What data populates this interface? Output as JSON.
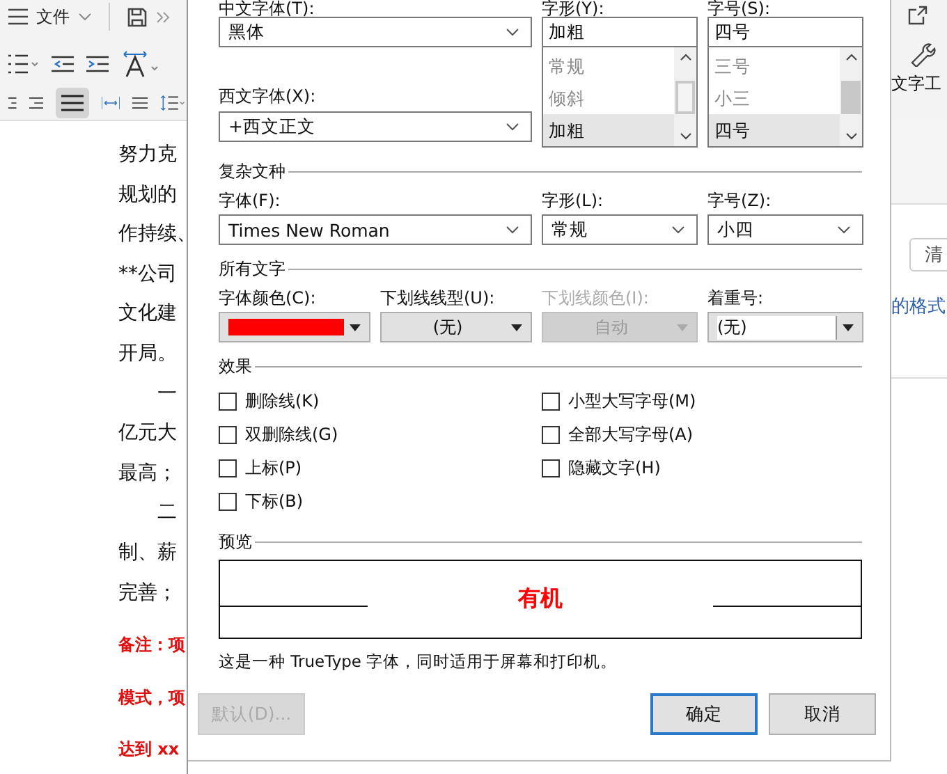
{
  "toolbar": {
    "menu_label": "文件"
  },
  "document": {
    "lines": [
      {
        "text": "努力克",
        "kind": "body"
      },
      {
        "text": "规划的",
        "kind": "body"
      },
      {
        "text": "作持续、",
        "kind": "body"
      },
      {
        "text": "**公司",
        "kind": "body"
      },
      {
        "text": "文化建",
        "kind": "body"
      },
      {
        "text": "开局。",
        "kind": "body"
      },
      {
        "text": "一",
        "kind": "indented"
      },
      {
        "text": "亿元大",
        "kind": "body"
      },
      {
        "text": "最高；",
        "kind": "body"
      },
      {
        "text": "二",
        "kind": "indented"
      },
      {
        "text": "制、薪",
        "kind": "body"
      },
      {
        "text": "完善；",
        "kind": "body"
      },
      {
        "text": "备注：项",
        "kind": "note"
      },
      {
        "text": "模式，项",
        "kind": "note"
      },
      {
        "text": "达到 xx",
        "kind": "note"
      }
    ]
  },
  "side_panel": {
    "tool_label": "文字工",
    "clear_button": "清",
    "link": "的格式"
  },
  "dialog": {
    "chinese_font": {
      "label": "中文字体(T):",
      "value": "黑体"
    },
    "style": {
      "label": "字形(Y):",
      "value": "加粗",
      "options": [
        {
          "label": "常规",
          "selected": false
        },
        {
          "label": "倾斜",
          "selected": false
        },
        {
          "label": "加粗",
          "selected": true
        }
      ]
    },
    "size": {
      "label": "字号(S):",
      "value": "四号",
      "options": [
        {
          "label": "三号",
          "selected": false
        },
        {
          "label": "小三",
          "selected": false
        },
        {
          "label": "四号",
          "selected": true
        }
      ]
    },
    "western_font": {
      "label": "西文字体(X):",
      "value": "+西文正文"
    },
    "complex_section": "复杂文种",
    "complex_font": {
      "label": "字体(F):",
      "value": "Times New Roman"
    },
    "complex_style": {
      "label": "字形(L):",
      "value": "常规"
    },
    "complex_size": {
      "label": "字号(Z):",
      "value": "小四"
    },
    "all_text_section": "所有文字",
    "font_color": {
      "label": "字体颜色(C):",
      "color": "#ff0000"
    },
    "underline_style": {
      "label": "下划线线型(U):",
      "value": "(无)",
      "disabled": false
    },
    "underline_color": {
      "label": "下划线颜色(I):",
      "value": "自动",
      "disabled": true
    },
    "emphasis": {
      "label": "着重号:",
      "value": "(无)",
      "disabled": false
    },
    "effects_section": "效果",
    "effects_left": [
      {
        "label": "删除线(K)",
        "checked": false
      },
      {
        "label": "双删除线(G)",
        "checked": false
      },
      {
        "label": "上标(P)",
        "checked": false
      },
      {
        "label": "下标(B)",
        "checked": false
      }
    ],
    "effects_right": [
      {
        "label": "小型大写字母(M)",
        "checked": false
      },
      {
        "label": "全部大写字母(A)",
        "checked": false
      },
      {
        "label": "隐藏文字(H)",
        "checked": false
      }
    ],
    "preview_section": "预览",
    "preview_text": "有机",
    "font_note": "这是一种 TrueType 字体，同时适用于屏幕和打印机。",
    "buttons": [
      {
        "label": "默认(D)...",
        "disabled": true,
        "default": false
      },
      {
        "label": "确定",
        "disabled": false,
        "default": true
      },
      {
        "label": "取消",
        "disabled": false,
        "default": false
      }
    ]
  }
}
